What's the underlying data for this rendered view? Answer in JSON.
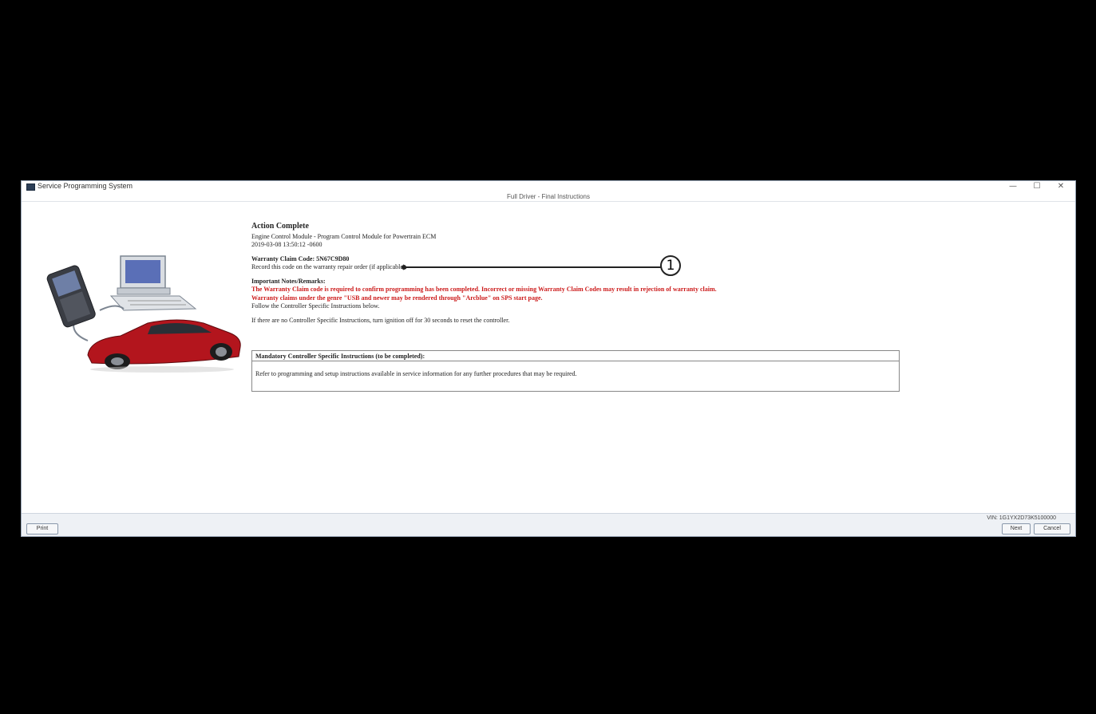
{
  "window": {
    "app_title": "Service Programming System",
    "subtitle": "Full Driver - Final Instructions",
    "minimize": "—",
    "maximize": "☐",
    "close": "✕"
  },
  "content": {
    "heading": "Action Complete",
    "line1": "Engine Control Module - Program Control Module for Powertrain ECM",
    "line2": "2019-03-08 13:50:12 -0600",
    "warranty_label": "Warranty Claim Code: 5N67C9D80",
    "warranty_note": "Record this code on the warranty repair order (if applicable).",
    "notes_heading": "Important Notes/Remarks:",
    "red_line1": "The Warranty Claim code is required to confirm programming has been completed. Incorrect or missing Warranty Claim Codes may result in rejection of warranty claim.",
    "red_line2": "Warranty claims under the genre \"USB and newer may be rendered through \"Arcblue\" on SPS start page.",
    "follow": "Follow the Controller Specific Instructions below.",
    "ignition": "If there are no Controller Specific Instructions, turn ignition off for 30 seconds to reset the controller.",
    "box_header": "Mandatory Controller Specific Instructions (to be completed):",
    "box_body": "Refer to programming and setup instructions available in service information for any further procedures that may be required."
  },
  "callout": {
    "number": "1"
  },
  "footer": {
    "vin": "VIN: 1G1YX2D73K5100000",
    "print_button": "Print",
    "next_button": "Next",
    "cancel_button": "Cancel"
  }
}
